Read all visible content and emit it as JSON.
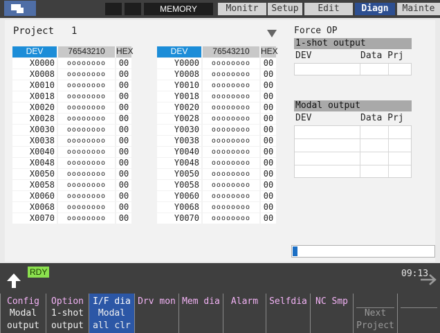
{
  "header": {
    "mode": "MEMORY",
    "tabs": [
      {
        "label": "Monitr",
        "active": false
      },
      {
        "label": "Setup",
        "active": false
      },
      {
        "label": "Edit",
        "active": false
      },
      {
        "label": "Diagn",
        "active": true
      },
      {
        "label": "Mainte",
        "active": false
      }
    ]
  },
  "project": {
    "label": "Project",
    "value": "1"
  },
  "table_left": {
    "headers": {
      "dev": "DEV",
      "bits": "76543210",
      "hex": "HEX"
    },
    "rows": [
      {
        "dev": "X0000",
        "bits": "oooooooo",
        "hex": "00"
      },
      {
        "dev": "X0008",
        "bits": "oooooooo",
        "hex": "00"
      },
      {
        "dev": "X0010",
        "bits": "oooooooo",
        "hex": "00"
      },
      {
        "dev": "X0018",
        "bits": "oooooooo",
        "hex": "00"
      },
      {
        "dev": "X0020",
        "bits": "oooooooo",
        "hex": "00"
      },
      {
        "dev": "X0028",
        "bits": "oooooooo",
        "hex": "00"
      },
      {
        "dev": "X0030",
        "bits": "oooooooo",
        "hex": "00"
      },
      {
        "dev": "X0038",
        "bits": "oooooooo",
        "hex": "00"
      },
      {
        "dev": "X0040",
        "bits": "oooooooo",
        "hex": "00"
      },
      {
        "dev": "X0048",
        "bits": "oooooooo",
        "hex": "00"
      },
      {
        "dev": "X0050",
        "bits": "oooooooo",
        "hex": "00"
      },
      {
        "dev": "X0058",
        "bits": "oooooooo",
        "hex": "00"
      },
      {
        "dev": "X0060",
        "bits": "oooooooo",
        "hex": "00"
      },
      {
        "dev": "X0068",
        "bits": "oooooooo",
        "hex": "00"
      },
      {
        "dev": "X0070",
        "bits": "oooooooo",
        "hex": "00"
      }
    ]
  },
  "table_right": {
    "headers": {
      "dev": "DEV",
      "bits": "76543210",
      "hex": "HEX"
    },
    "rows": [
      {
        "dev": "Y0000",
        "bits": "oooooooo",
        "hex": "00"
      },
      {
        "dev": "Y0008",
        "bits": "oooooooo",
        "hex": "00"
      },
      {
        "dev": "Y0010",
        "bits": "oooooooo",
        "hex": "00"
      },
      {
        "dev": "Y0018",
        "bits": "oooooooo",
        "hex": "00"
      },
      {
        "dev": "Y0020",
        "bits": "oooooooo",
        "hex": "00"
      },
      {
        "dev": "Y0028",
        "bits": "oooooooo",
        "hex": "00"
      },
      {
        "dev": "Y0030",
        "bits": "oooooooo",
        "hex": "00"
      },
      {
        "dev": "Y0038",
        "bits": "oooooooo",
        "hex": "00"
      },
      {
        "dev": "Y0040",
        "bits": "oooooooo",
        "hex": "00"
      },
      {
        "dev": "Y0048",
        "bits": "oooooooo",
        "hex": "00"
      },
      {
        "dev": "Y0050",
        "bits": "oooooooo",
        "hex": "00"
      },
      {
        "dev": "Y0058",
        "bits": "oooooooo",
        "hex": "00"
      },
      {
        "dev": "Y0060",
        "bits": "oooooooo",
        "hex": "00"
      },
      {
        "dev": "Y0068",
        "bits": "oooooooo",
        "hex": "00"
      },
      {
        "dev": "Y0070",
        "bits": "oooooooo",
        "hex": "00"
      }
    ]
  },
  "force_op": {
    "title": "Force OP",
    "oneshot": {
      "title": "1-shot output",
      "col_dev": "DEV",
      "col_data_prj": "Data Prj"
    },
    "modal": {
      "title": "Modal output",
      "col_dev": "DEV",
      "col_data_prj": "Data Prj"
    }
  },
  "status": {
    "ready": "RDY",
    "time": "09:13"
  },
  "function_keys": [
    {
      "l1": "Config",
      "l2": "Modal",
      "l3": "output",
      "selected": false,
      "disabled": false
    },
    {
      "l1": "Option",
      "l2": "1-shot",
      "l3": "output",
      "selected": false,
      "disabled": false
    },
    {
      "l1": "I/F dia",
      "l2": "Modal",
      "l3": "all clr",
      "selected": true,
      "disabled": false
    },
    {
      "l1": "Drv mon",
      "l2": "",
      "l3": "",
      "selected": false,
      "disabled": false
    },
    {
      "l1": "Mem dia",
      "l2": "",
      "l3": "",
      "selected": false,
      "disabled": false
    },
    {
      "l1": "Alarm",
      "l2": "",
      "l3": "",
      "selected": false,
      "disabled": false
    },
    {
      "l1": "Selfdia",
      "l2": "",
      "l3": "",
      "selected": false,
      "disabled": false
    },
    {
      "l1": "NC Smp",
      "l2": "",
      "l3": "",
      "selected": false,
      "disabled": false
    },
    {
      "l1": "",
      "l2": "Next",
      "l3": "Project",
      "selected": false,
      "disabled": true
    },
    {
      "l1": "",
      "l2": "",
      "l3": "",
      "selected": false,
      "disabled": false
    }
  ],
  "colors": {
    "accent": "#2d4f91",
    "header_blue": "#1c8dd8",
    "ready_green": "#8be04e"
  },
  "icons": {
    "up": "up-arrow-icon",
    "next": "right-arrow-icon",
    "project_dropdown": "triangle-down-icon"
  }
}
